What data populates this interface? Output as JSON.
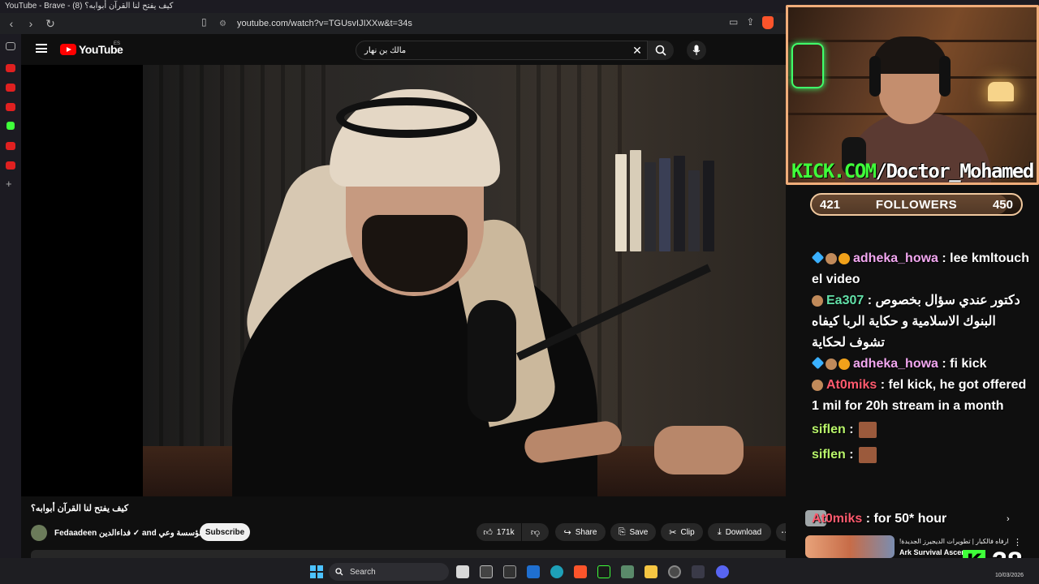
{
  "browser": {
    "window_title": "YouTube - Brave - (8) كيف يفتح لنا القرآن أبوابه؟",
    "url": "youtube.com/watch?v=TGUsvIJIXXw&t=34s"
  },
  "youtube": {
    "logo_text": "YouTube",
    "country_code": "ES",
    "search_query": "مالك بن نهار"
  },
  "video": {
    "title": "كيف يفتح لنا القرآن أبوابه؟",
    "channel": "Fedaadeen فداءالدين ✓ and مؤسسة وعي ✓",
    "subscribe_label": "Subscribe",
    "actions": {
      "likes": "171k",
      "share": "Share",
      "save": "Save",
      "clip": "Clip",
      "download": "Download"
    },
    "icons": {
      "like": "thumbs-up-icon",
      "dislike": "thumbs-down-icon",
      "share": "share-arrow-icon",
      "save": "bookmark-icon",
      "clip": "scissors-icon",
      "download": "download-icon",
      "more": "more-dots-icon"
    }
  },
  "recommendations": [
    {
      "title": "ارفاه فالكبار | تطويرات الديجيرز الجديدة!",
      "channel": "Ark Survival Ascen"
    }
  ],
  "stream_overlay": {
    "webcam_caption_green": "KICK.COM",
    "webcam_caption_white": "/Doctor_Mohamed",
    "followers": {
      "current": "421",
      "label": "FOLLOWERS",
      "goal": "450",
      "progress": 0.9356
    },
    "chat": [
      {
        "user": "adheka_howa",
        "color": "#f2a7f0",
        "badges": [
          "diamond",
          "avatar",
          "coin"
        ],
        "text": ": lee kmltouch el video"
      },
      {
        "user": "Ea307",
        "color": "#62e0a8",
        "badges": [
          "avatar"
        ],
        "text": ": دكتور عندي سؤال بخصوص البنوك الاسلامية و حكاية الربا كيفاه تشوف لحكاية"
      },
      {
        "user": "adheka_howa",
        "color": "#f2a7f0",
        "badges": [
          "diamond",
          "avatar",
          "coin"
        ],
        "text": ": fi kick"
      },
      {
        "user": "At0miks",
        "color": "#ff5a6e",
        "badges": [
          "avatar"
        ],
        "text": ": fel kick, he got offered 1 mil for 20h stream in a month"
      },
      {
        "user": "siflen",
        "color": "#b8f56a",
        "badges": [],
        "text": ":"
      },
      {
        "user": "siflen",
        "color": "#b8f56a",
        "badges": [],
        "text": ":"
      }
    ],
    "last_message": {
      "user": "At0miks",
      "color": "#ff5a6e",
      "text": ": for 50* hour"
    },
    "kick_viewers": "38"
  },
  "taskbar": {
    "search_placeholder": "Search",
    "date": "10/03/2026"
  },
  "colors": {
    "yt_red": "#ff0000",
    "kick_green": "#3fff3a",
    "overlay_border": "#f0ad7a"
  }
}
